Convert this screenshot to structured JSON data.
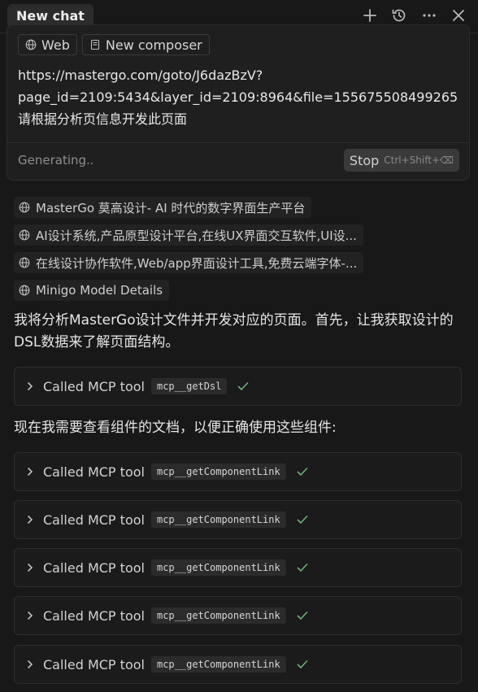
{
  "header": {
    "tab_title": "New chat",
    "icons": [
      "plus-icon",
      "history-icon",
      "more-icon",
      "close-icon"
    ]
  },
  "composer": {
    "chips": [
      {
        "label": "Web",
        "icon": "globe-icon"
      },
      {
        "label": "New composer",
        "icon": "composer-icon"
      }
    ],
    "prompt_lines": [
      "https://mastergo.com/goto/J6dazBzV?",
      "page_id=2109:5434&layer_id=2109:8964&file=155675508499265",
      "请根据分析页信息开发此页面"
    ],
    "status": "Generating..",
    "stop_label": "Stop",
    "stop_shortcut": "Ctrl+Shift+⌫"
  },
  "sources": [
    {
      "label": "MasterGo 莫高设计- AI 时代的数字界面生产平台",
      "icon": "globe-icon"
    },
    {
      "label": "AI设计系统,产品原型设计平台,在线UX界面交互软件,UI设...",
      "icon": "globe-icon"
    },
    {
      "label": "在线设计协作软件,Web/app界面设计工具,免费云端字体-...",
      "icon": "globe-icon"
    },
    {
      "label": "Minigo Model Details",
      "icon": "globe-icon"
    }
  ],
  "messages": {
    "intro": "我将分析MasterGo设计文件并开发对应的页面。首先，让我获取设计的DSL数据来了解页面结构。",
    "followup": "现在我需要查看组件的文档，以便正确使用这些组件:"
  },
  "tool_calls": [
    {
      "label": "Called MCP tool",
      "tool": "mcp__getDsl"
    },
    {
      "label": "Called MCP tool",
      "tool": "mcp__getComponentLink"
    },
    {
      "label": "Called MCP tool",
      "tool": "mcp__getComponentLink"
    },
    {
      "label": "Called MCP tool",
      "tool": "mcp__getComponentLink"
    },
    {
      "label": "Called MCP tool",
      "tool": "mcp__getComponentLink"
    },
    {
      "label": "Called MCP tool",
      "tool": "mcp__getComponentLink"
    }
  ],
  "colors": {
    "background": "#181818",
    "card": "#1b1b1b",
    "success": "#6fb07a"
  }
}
